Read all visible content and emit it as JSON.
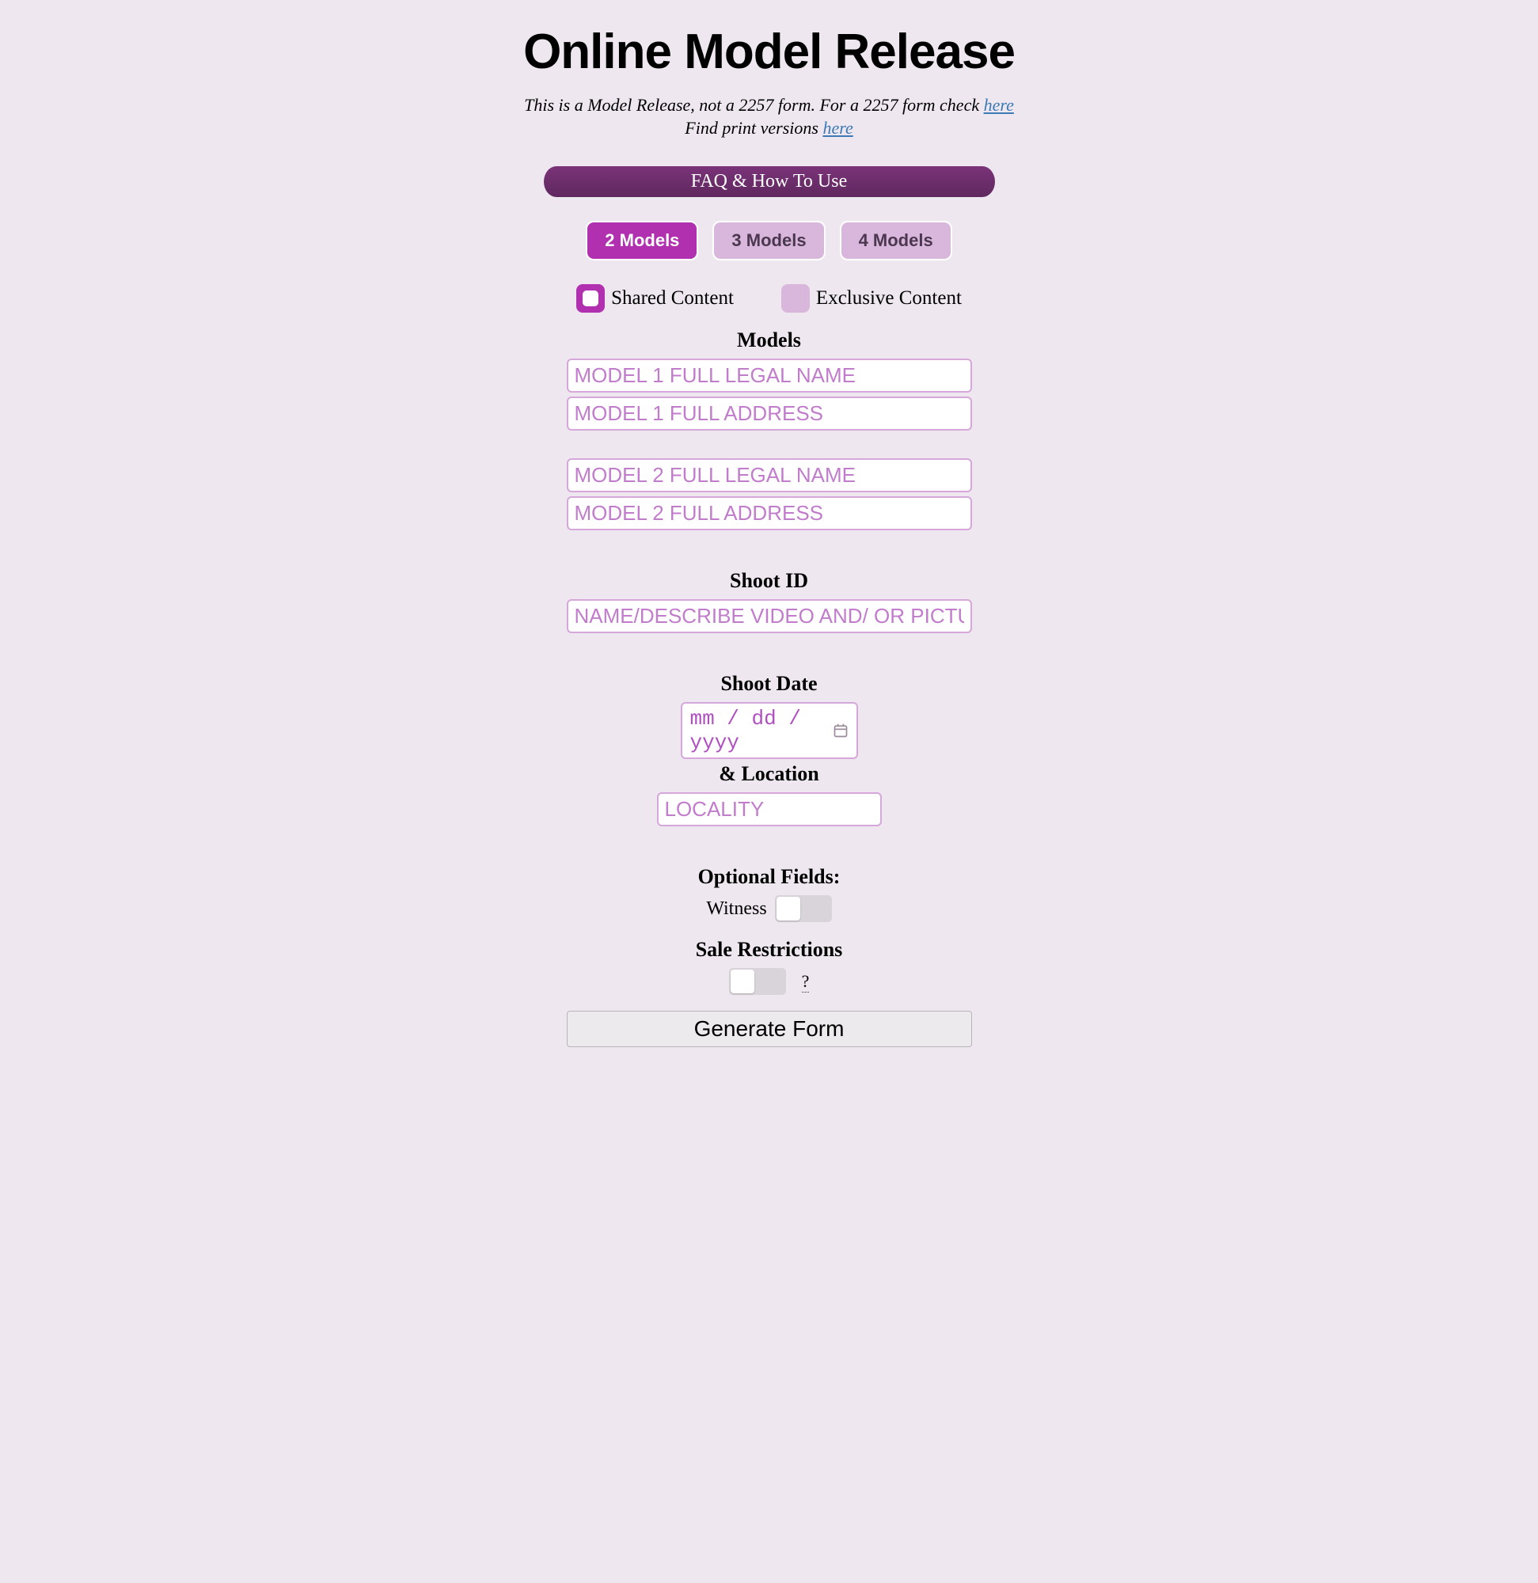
{
  "title": "Online Model Release",
  "subtitle": {
    "line1_prefix": "This is a Model Release, not a 2257 form. For a 2257 form check ",
    "line1_link": "here",
    "line2_prefix": "Find print versions ",
    "line2_link": "here"
  },
  "faq_bar": "FAQ & How To Use",
  "tabs": [
    "2 Models",
    "3 Models",
    "4 Models"
  ],
  "active_tab_index": 0,
  "content_type": {
    "shared_label": "Shared Content",
    "exclusive_label": "Exclusive Content",
    "shared_checked": true,
    "exclusive_checked": false
  },
  "sections": {
    "models": "Models",
    "shoot_id": "Shoot ID",
    "shoot_date": "Shoot Date",
    "and_location": "& Location",
    "optional_fields": "Optional Fields:",
    "sale_restrictions": "Sale Restrictions"
  },
  "placeholders": {
    "model1_name": "MODEL 1 FULL LEGAL NAME",
    "model1_addr": "MODEL 1 FULL ADDRESS",
    "model2_name": "MODEL 2 FULL LEGAL NAME",
    "model2_addr": "MODEL 2 FULL ADDRESS",
    "shoot_id": "NAME/DESCRIBE VIDEO AND/ OR PICTURES",
    "date": "mm / dd / yyyy",
    "locality": "LOCALITY"
  },
  "witness_label": "Witness",
  "sale_hint": "?",
  "generate_label": "Generate Form",
  "colors": {
    "accent": "#b030b0",
    "faq_bg": "#6d2b6e",
    "tab_inactive": "#d9b7dc",
    "border": "#d6a7da",
    "page_bg": "#eee7ef"
  }
}
